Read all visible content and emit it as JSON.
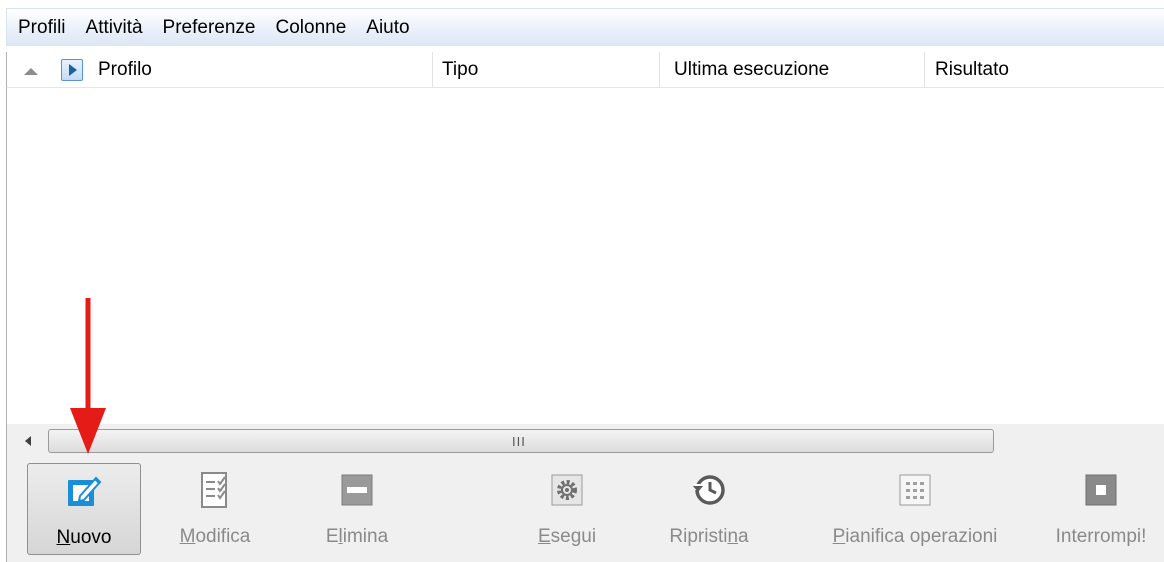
{
  "menu": {
    "items": [
      "Profili",
      "Attività",
      "Preferenze",
      "Colonne",
      "Aiuto"
    ]
  },
  "columns": {
    "profilo": "Profilo",
    "tipo": "Tipo",
    "ultima": "Ultima esecuzione",
    "risultato": "Risultato"
  },
  "scrollbar": {
    "grip": "III"
  },
  "toolbar": {
    "buttons": [
      {
        "label": "Nuovo",
        "mnemonic": "N",
        "rest": "uovo",
        "icon": "new-profile-icon",
        "enabled": true
      },
      {
        "label": "Modifica",
        "mnemonic": "M",
        "rest": "odifica",
        "icon": "edit-checklist-icon",
        "enabled": false
      },
      {
        "label": "Elimina",
        "pre": "E",
        "mnemonic": "l",
        "rest": "imina",
        "icon": "delete-icon",
        "enabled": false
      },
      {
        "label": "Esegui",
        "mnemonic": "E",
        "rest": "segui",
        "icon": "gear-icon",
        "enabled": false
      },
      {
        "label": "Ripristina",
        "pre": "Ripristi",
        "mnemonic": "n",
        "rest": "a",
        "icon": "restore-history-icon",
        "enabled": false
      },
      {
        "label": "Pianifica operazioni",
        "mnemonic": "P",
        "rest": "ianifica operazioni",
        "icon": "schedule-grid-icon",
        "enabled": false
      },
      {
        "label": "Interrompi!",
        "icon": "stop-icon",
        "enabled": false
      }
    ]
  },
  "colors": {
    "accent": "#1a8fd8",
    "annotation_arrow": "#e41b17",
    "disabled_text": "#8a8a8a"
  }
}
